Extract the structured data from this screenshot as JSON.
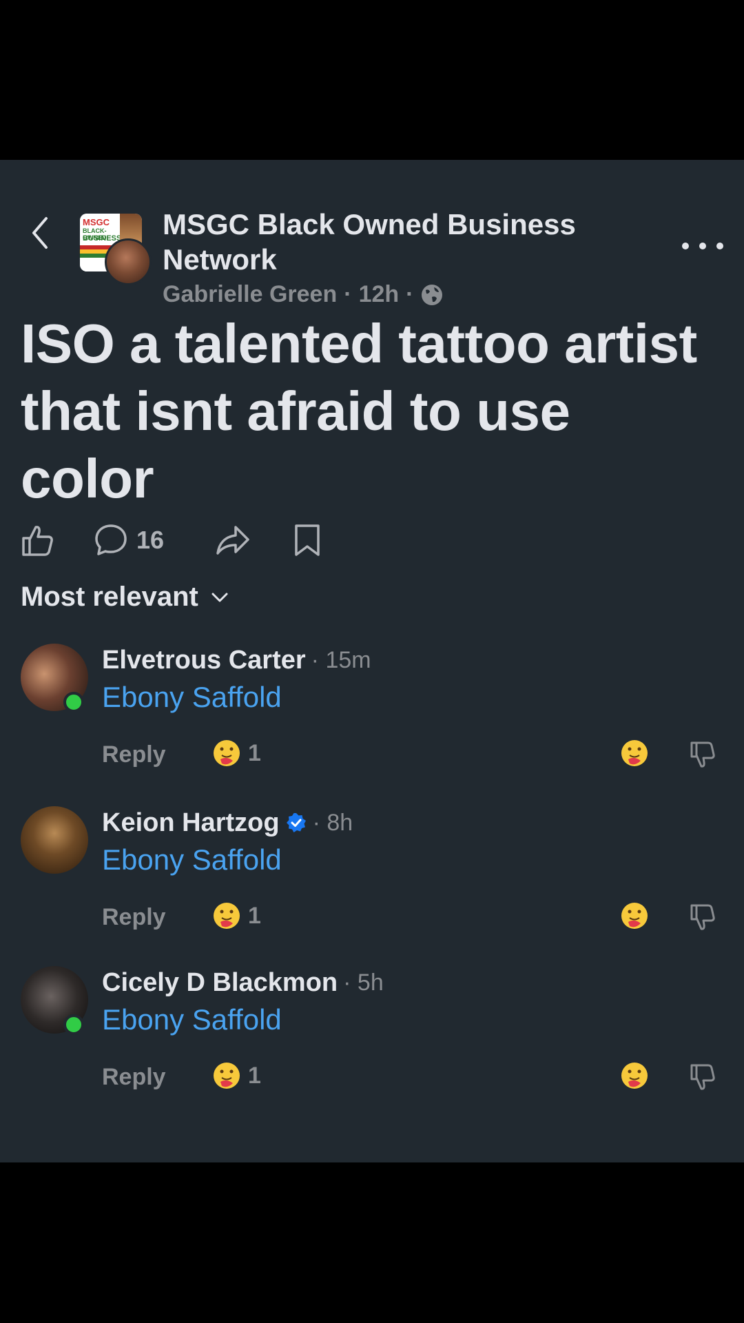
{
  "header": {
    "group_name": "MSGC Black Owned Business Network",
    "author": "Gabrielle Green",
    "separator": "·",
    "time": "12h",
    "group_avatar_text": [
      "MSGC",
      "BLACK-OWNED",
      "BUSINESS"
    ]
  },
  "post": {
    "title": "ISO a talented tattoo artist that isnt afraid to use color",
    "comment_count": "16"
  },
  "sort": {
    "label": "Most relevant"
  },
  "comments": [
    {
      "name": "Elvetrous Carter",
      "time": "· 15m",
      "body": "Ebony Saffold",
      "reply_label": "Reply",
      "reactions": "1",
      "online": true,
      "verified": false
    },
    {
      "name": "Keion Hartzog",
      "time": "· 8h",
      "body": "Ebony Saffold",
      "reply_label": "Reply",
      "reactions": "1",
      "online": false,
      "verified": true
    },
    {
      "name": "Cicely D Blackmon",
      "time": "· 5h",
      "body": "Ebony Saffold",
      "reply_label": "Reply",
      "reactions": "1",
      "online": true,
      "verified": false
    }
  ],
  "colors": {
    "background": "#212930",
    "text_primary": "#e4e6eb",
    "text_secondary": "#8a8d91",
    "link": "#4aa3f0",
    "online": "#31cc46",
    "verified": "#1877f2"
  },
  "icons": [
    "back-arrow-icon",
    "globe-icon",
    "more-icon",
    "like-icon",
    "comment-icon",
    "share-icon",
    "bookmark-icon",
    "chevron-down-icon",
    "hug-emoji-icon",
    "dislike-icon",
    "verified-badge-icon"
  ]
}
